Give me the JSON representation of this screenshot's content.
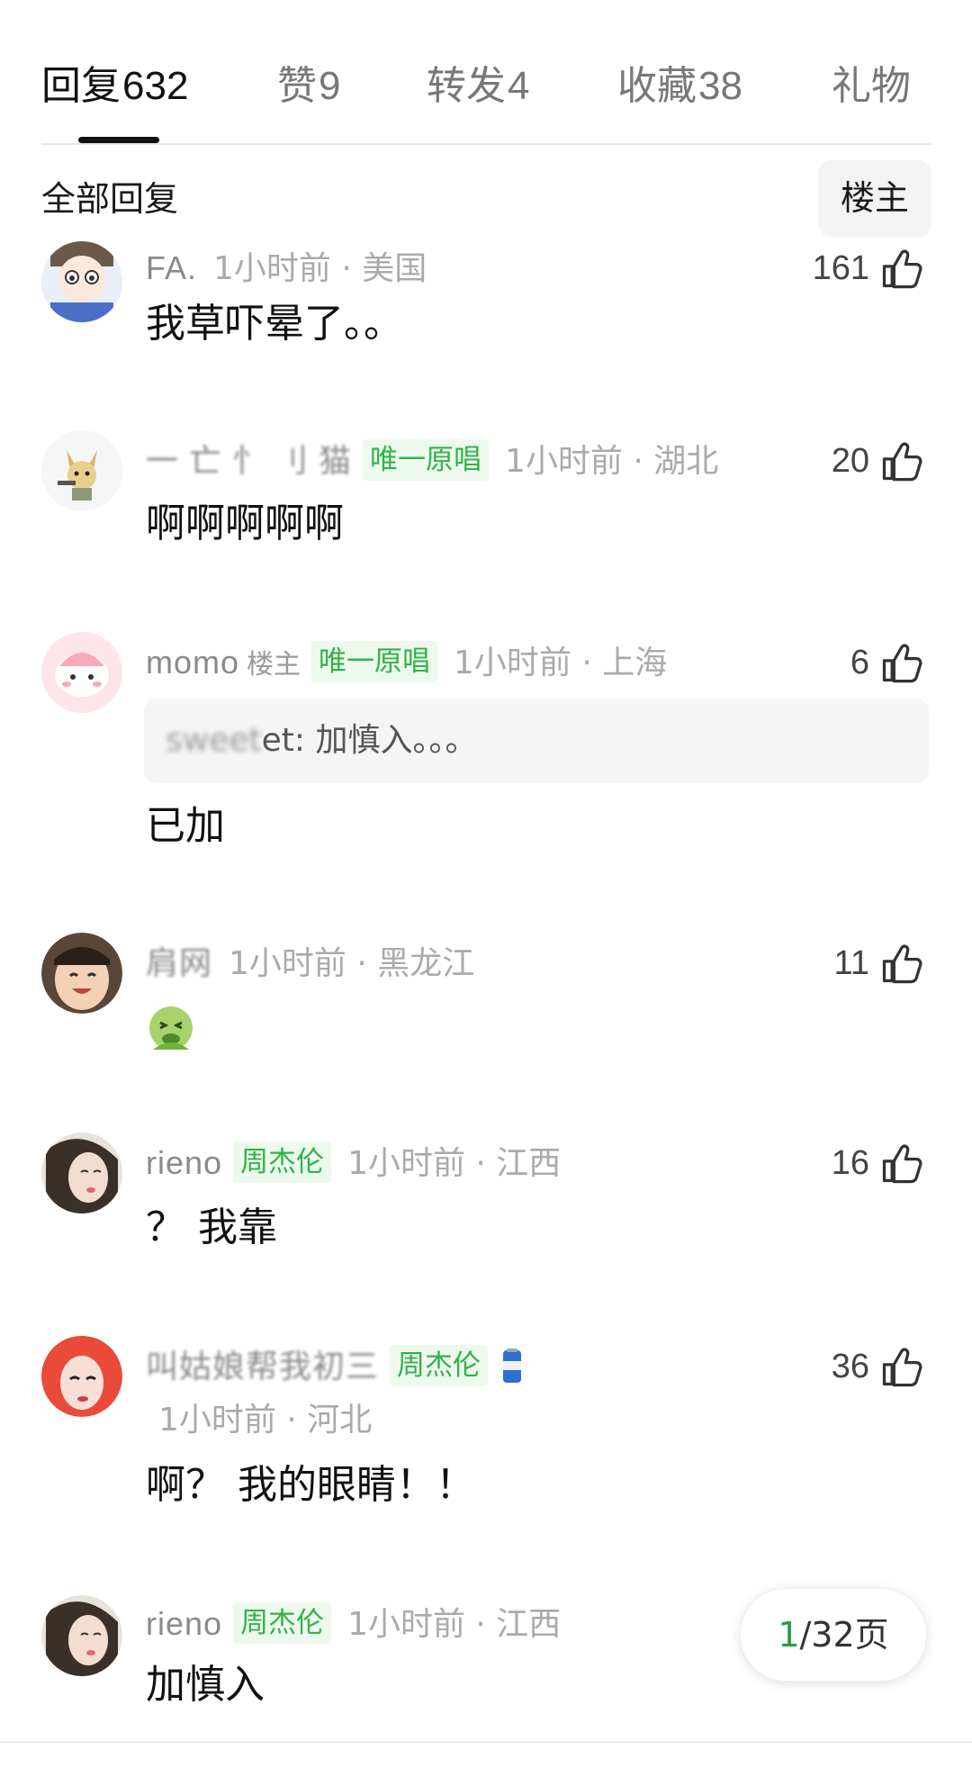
{
  "tabs": [
    {
      "label": "回复",
      "count": "632"
    },
    {
      "label": "赞",
      "count": "9"
    },
    {
      "label": "转发",
      "count": "4"
    },
    {
      "label": "收藏",
      "count": "38"
    },
    {
      "label": "礼物",
      "count": ""
    }
  ],
  "filter": {
    "label": "全部回复",
    "op_button": "楼主"
  },
  "comments": [
    {
      "name": "FA.",
      "time_loc": "1小时前 · 美国",
      "likes": "161",
      "text": "我草吓晕了。。"
    },
    {
      "name": "一 亡 忄 刂 猫",
      "badge": "唯一原唱",
      "time_loc": "1小时前 · 湖北",
      "likes": "20",
      "text": "啊啊啊啊啊"
    },
    {
      "name": "momo",
      "op_tag": "楼主",
      "badge": "唯一原唱",
      "time_loc": "1小时前 · 上海",
      "likes": "6",
      "quote_author": "sweet",
      "quote_text": "et: 加慎入。。。",
      "text": "已加"
    },
    {
      "name": "肩网",
      "time_loc": "1小时前 · 黑龙江",
      "likes": "11",
      "emoji": "nauseated-face-emoji"
    },
    {
      "name": "rieno",
      "badge": "周杰伦",
      "time_loc": "1小时前 · 江西",
      "likes": "16",
      "text": "？ 我靠"
    },
    {
      "name": "叫姑娘帮我初三",
      "badge": "周杰伦",
      "time_loc": "1小时前 · 河北",
      "likes": "36",
      "text": "啊？ 我的眼睛！！"
    },
    {
      "name": "rieno",
      "badge": "周杰伦",
      "time_loc": "1小时前 · 江西",
      "text": "加慎入"
    }
  ],
  "pagination": {
    "current": "1",
    "rest": "/32页"
  }
}
